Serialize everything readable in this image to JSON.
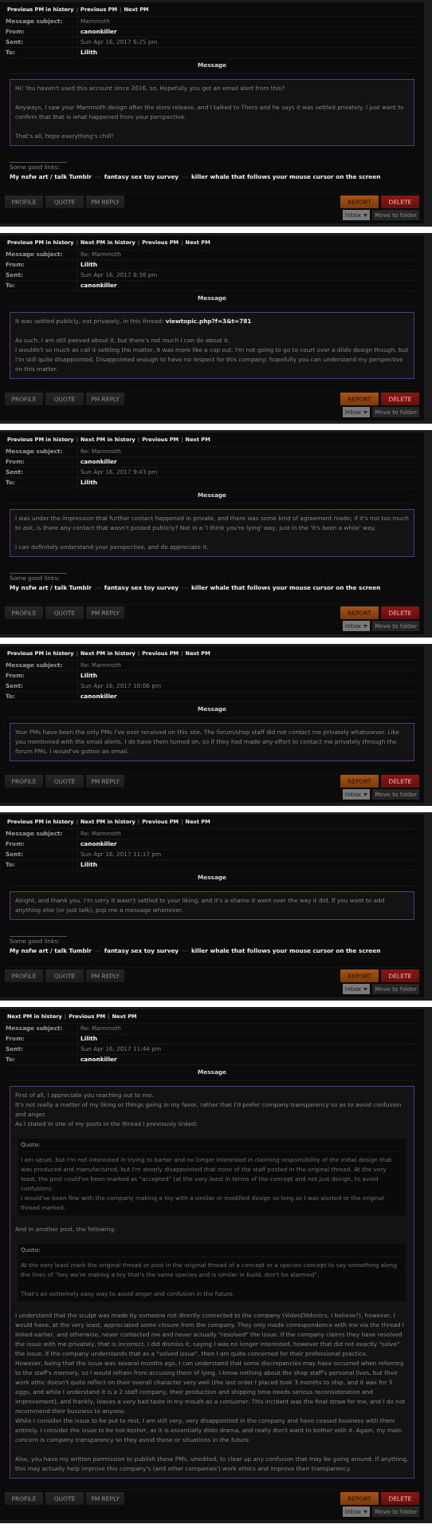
{
  "messages": [
    {
      "nav": [
        {
          "kind": "link",
          "text": "Previous PM in history"
        },
        {
          "kind": "sep",
          "text": "|"
        },
        {
          "kind": "link",
          "text": "Previous PM"
        },
        {
          "kind": "sep",
          "text": "|"
        },
        {
          "kind": "link",
          "text": "Next PM"
        }
      ],
      "fields": [
        {
          "label": "Message subject:",
          "value": "Mammoth",
          "kind": "plain"
        },
        {
          "label": "From:",
          "value": "canonkiller",
          "kind": "user"
        },
        {
          "label": "Sent:",
          "value": "Sun Apr 16, 2017 6:25 pm",
          "kind": "plain"
        },
        {
          "label": "To:",
          "value": "Lilith",
          "kind": "user"
        }
      ],
      "heading": "Message",
      "body": [
        {
          "kind": "text",
          "lines": [
            "Hi! You haven't used this account since 2016, so. Hopefully you get an email alert from this?"
          ]
        },
        {
          "kind": "text",
          "lines": [
            "Anyways, I saw your Mammoth design after the store release, and I talked to Thero and he says it was settled privately. I just want to confirm that that is what happened from your perspective."
          ]
        },
        {
          "kind": "text",
          "lines": [
            "That's all, hope everything's chill!"
          ]
        }
      ],
      "signature": {
        "intro": "Some good links:",
        "parts": [
          {
            "kind": "link",
            "text": "My nsfw art / talk Tumblr"
          },
          {
            "kind": "sep",
            "text": "---"
          },
          {
            "kind": "link",
            "text": "fantasy sex toy survey"
          },
          {
            "kind": "sep",
            "text": "---"
          },
          {
            "kind": "link",
            "text": "killer whale that follows your mouse cursor on the screen"
          }
        ]
      },
      "buttons_left": [
        "PROFILE",
        "QUOTE",
        "PM REPLY"
      ],
      "buttons_right": [
        {
          "kind": "report",
          "text": "REPORT"
        },
        {
          "kind": "delete",
          "text": "DELETE"
        }
      ],
      "folder": {
        "select": "Inbox",
        "button": "Move to folder"
      }
    },
    {
      "nav": [
        {
          "kind": "link",
          "text": "Previous PM in history"
        },
        {
          "kind": "sep",
          "text": "|"
        },
        {
          "kind": "link",
          "text": "Next PM in history"
        },
        {
          "kind": "sep",
          "text": "|"
        },
        {
          "kind": "link",
          "text": "Previous PM"
        },
        {
          "kind": "sep",
          "text": "|"
        },
        {
          "kind": "link",
          "text": "Next PM"
        }
      ],
      "fields": [
        {
          "label": "Message subject:",
          "value": "Re: Mammoth",
          "kind": "plain"
        },
        {
          "label": "From:",
          "value": "Lilith",
          "kind": "user"
        },
        {
          "label": "Sent:",
          "value": "Sun Apr 16, 2017 8:38 pm",
          "kind": "plain"
        },
        {
          "label": "To:",
          "value": "canonkiller",
          "kind": "user"
        }
      ],
      "heading": "Message",
      "body": [
        {
          "kind": "text",
          "lines": [
            "It was settled publicly, not privately, in this thread: "
          ],
          "link": "viewtopic.php?f=3&t=781"
        },
        {
          "kind": "text",
          "lines": [
            "As such, I am still peeved about it, but there's not much I can do about it.",
            "I wouldn't so much as call it settling the matter, it was more like a cop out. I'm not going to go to court over a dildo design though, but I'm still quite disappointed. Disappointed enough to have no respect for this company; hopefully you can understand my perspective on this matter."
          ]
        }
      ],
      "buttons_left": [
        "PROFILE",
        "QUOTE",
        "PM REPLY"
      ],
      "buttons_right": [
        {
          "kind": "report",
          "text": "REPORT"
        },
        {
          "kind": "delete",
          "text": "DELETE"
        }
      ],
      "folder": {
        "select": "Inbox",
        "button": "Move to folder"
      }
    },
    {
      "nav": [
        {
          "kind": "link",
          "text": "Previous PM in history"
        },
        {
          "kind": "sep",
          "text": "|"
        },
        {
          "kind": "link",
          "text": "Next PM in history"
        },
        {
          "kind": "sep",
          "text": "|"
        },
        {
          "kind": "link",
          "text": "Previous PM"
        },
        {
          "kind": "sep",
          "text": "|"
        },
        {
          "kind": "link",
          "text": "Next PM"
        }
      ],
      "fields": [
        {
          "label": "Message subject:",
          "value": "Re: Mammoth",
          "kind": "plain"
        },
        {
          "label": "From:",
          "value": "canonkiller",
          "kind": "user"
        },
        {
          "label": "Sent:",
          "value": "Sun Apr 16, 2017 9:43 pm",
          "kind": "plain"
        },
        {
          "label": "To:",
          "value": "Lilith",
          "kind": "user"
        }
      ],
      "heading": "Message",
      "body": [
        {
          "kind": "text",
          "lines": [
            "I was under the impression that further contact happened in private, and there was some kind of agreement made; if it's not too much to ask, is there any contact that wasn't posted publicly? Not in a 'I think you're lying' way, just in the 'it's been a while' way."
          ]
        },
        {
          "kind": "text",
          "lines": [
            "I can definitely understand your perspective, and do appreciate it."
          ]
        }
      ],
      "signature": {
        "intro": "Some good links:",
        "parts": [
          {
            "kind": "link",
            "text": "My nsfw art / talk Tumblr"
          },
          {
            "kind": "sep",
            "text": "---"
          },
          {
            "kind": "link",
            "text": "fantasy sex toy survey"
          },
          {
            "kind": "sep",
            "text": "---"
          },
          {
            "kind": "link",
            "text": "killer whale that follows your mouse cursor on the screen"
          }
        ]
      },
      "buttons_left": [
        "PROFILE",
        "QUOTE",
        "PM REPLY"
      ],
      "buttons_right": [
        {
          "kind": "report",
          "text": "REPORT"
        },
        {
          "kind": "delete",
          "text": "DELETE"
        }
      ],
      "folder": {
        "select": "Inbox",
        "button": "Move to folder"
      }
    },
    {
      "nav": [
        {
          "kind": "link",
          "text": "Previous PM in history"
        },
        {
          "kind": "sep",
          "text": "|"
        },
        {
          "kind": "link",
          "text": "Next PM in history"
        },
        {
          "kind": "sep",
          "text": "|"
        },
        {
          "kind": "link",
          "text": "Previous PM"
        },
        {
          "kind": "sep",
          "text": "|"
        },
        {
          "kind": "link",
          "text": "Next PM"
        }
      ],
      "fields": [
        {
          "label": "Message subject:",
          "value": "Re: Mammoth",
          "kind": "plain"
        },
        {
          "label": "From:",
          "value": "Lilith",
          "kind": "user"
        },
        {
          "label": "Sent:",
          "value": "Sun Apr 16, 2017 10:06 pm",
          "kind": "plain"
        },
        {
          "label": "To:",
          "value": "canonkiller",
          "kind": "user"
        }
      ],
      "heading": "Message",
      "body": [
        {
          "kind": "text",
          "lines": [
            "Your PMs have been the only PMs I've ever received on this site. The forum/shop staff did not contact me privately whatsoever. Like you mentioned with the email alerts, I do have them turned on, so if they had made any effort to contact me privately through the forum PMs, I would've gotten an email."
          ]
        }
      ],
      "buttons_left": [
        "PROFILE",
        "QUOTE",
        "PM REPLY"
      ],
      "buttons_right": [
        {
          "kind": "report",
          "text": "REPORT"
        },
        {
          "kind": "delete",
          "text": "DELETE"
        }
      ],
      "folder": {
        "select": "Inbox",
        "button": "Move to folder"
      }
    },
    {
      "nav": [
        {
          "kind": "link",
          "text": "Previous PM in history"
        },
        {
          "kind": "sep",
          "text": "|"
        },
        {
          "kind": "link",
          "text": "Next PM in history"
        },
        {
          "kind": "sep",
          "text": "|"
        },
        {
          "kind": "link",
          "text": "Previous PM"
        },
        {
          "kind": "sep",
          "text": "|"
        },
        {
          "kind": "link",
          "text": "Next PM"
        }
      ],
      "fields": [
        {
          "label": "Message subject:",
          "value": "Re: Mammoth",
          "kind": "plain"
        },
        {
          "label": "From:",
          "value": "canonkiller",
          "kind": "user"
        },
        {
          "label": "Sent:",
          "value": "Sun Apr 16, 2017 11:17 pm",
          "kind": "plain"
        },
        {
          "label": "To:",
          "value": "Lilith",
          "kind": "user"
        }
      ],
      "heading": "Message",
      "body": [
        {
          "kind": "text",
          "lines": [
            "Alright, and thank you. I'm sorry it wasn't settled to your liking, and it's a shame it went over the way it did. If you want to add anything else (or just talk), pop me a message whenever."
          ]
        }
      ],
      "signature": {
        "intro": "Some good links:",
        "parts": [
          {
            "kind": "link",
            "text": "My nsfw art / talk Tumblr"
          },
          {
            "kind": "sep",
            "text": "---"
          },
          {
            "kind": "link",
            "text": "fantasy sex toy survey"
          },
          {
            "kind": "sep",
            "text": "---"
          },
          {
            "kind": "link",
            "text": "killer whale that follows your mouse cursor on the screen"
          }
        ]
      },
      "buttons_left": [
        "PROFILE",
        "QUOTE",
        "PM REPLY"
      ],
      "buttons_right": [
        {
          "kind": "report",
          "text": "REPORT"
        },
        {
          "kind": "delete",
          "text": "DELETE"
        }
      ],
      "folder": {
        "select": "Inbox",
        "button": "Move to folder"
      }
    },
    {
      "nav": [
        {
          "kind": "link",
          "text": "Next PM in history"
        },
        {
          "kind": "sep",
          "text": "|"
        },
        {
          "kind": "link",
          "text": "Previous PM"
        },
        {
          "kind": "sep",
          "text": "|"
        },
        {
          "kind": "link",
          "text": "Next PM"
        }
      ],
      "fields": [
        {
          "label": "Message subject:",
          "value": "Re: Mammoth",
          "kind": "plain"
        },
        {
          "label": "From:",
          "value": "Lilith",
          "kind": "user"
        },
        {
          "label": "Sent:",
          "value": "Sun Apr 16, 2017 11:44 pm",
          "kind": "plain"
        },
        {
          "label": "To:",
          "value": "canonkiller",
          "kind": "user"
        }
      ],
      "heading": "Message",
      "body": [
        {
          "kind": "text",
          "lines": [
            "First of all, I appreciate you reaching out to me.",
            "It's not really a matter of my liking or things going in my favor, rather that I'd prefer company transparency so as to avoid confusion and anger.",
            "As I stated in one of my posts in the thread I previously linked:"
          ]
        },
        {
          "kind": "quote",
          "label": "Quote:",
          "paragraphs": [
            {
              "lines": [
                "I am upset, but I'm not interested in trying to barter and no longer interested in claiming responsibility of the initial design that was produced and manufactured, but I'm deeply disappointed that none of the staff posted in the original thread. At the very least, the post could've been marked as \"accepted\" (at the very least in terms of the concept and not just design, to avoid confusion).",
                "I would've been fine with the company making a toy with a similar or modified design so long as I was alerted or the original thread marked."
              ]
            }
          ]
        },
        {
          "kind": "text",
          "lines": [
            "And in another post, the following:"
          ]
        },
        {
          "kind": "quote",
          "label": "Quote:",
          "paragraphs": [
            {
              "lines": [
                "At the very least mark the original thread or post in the original thread of a concept or a species concept to say something along the lines of \"hey we're making a toy that's the same species and is similar in build, don't be alarmed\"."
              ]
            },
            {
              "lines": [
                "That's an extremely easy way to avoid anger and confusion in the future."
              ]
            }
          ]
        },
        {
          "kind": "text",
          "lines": [
            "I understand that the sculpt was made by someone not directly connected to the company (VideoDildonics, I believe?), however, I would have, at the very least, appreciated some closure from the company. They only made correspondence with me via the thread I linked earlier, and otherwise, never contacted me and never actually \"resolved\" the issue. If the company claims they have resolved the issue with me privately, that is incorrect. I did dismiss it, saying I was no longer interested, however that did not exactly \"solve\" the issue. If the company understands that as a \"solved issue\", then I am quite concerned for their professional practice.",
            "However, being that the issue was several months ago, I can understand that some discrepancies may have occurred when referring to the staff's memory, so I would refrain from accusing them of lying. I know nothing about the shop staff's personal lives, but their work ethic doesn't quite reflect on their overall character very well (the last order I placed took 3 months to ship, and it was for 3 eggs, and while I understand it is a 2 staff company, their production and shipping time needs serious reconsideration and improvement), and frankly, leaves a very bad taste in my mouth as a consumer. This incident was the final straw for me, and I do not recommend their business to anyone.",
            "While I consider the issue to be put to rest, I am still very, very disappointed in the company and have ceased business with them entirely. I consider the issue to be not-kosher, as it is essentially dildo drama, and really don't want to bother with it. Again, my main concern is company transparency so they avoid these or situations in the future."
          ]
        },
        {
          "kind": "text",
          "lines": [
            "Also, you have my written permission to publish these PMs, unedited, to clear up any confusion that may be going around. If anything, this may actually help improve this company's (and other companies') work ethics and improve their transparency."
          ]
        }
      ],
      "buttons_left": [
        "PROFILE",
        "QUOTE",
        "PM REPLY"
      ],
      "buttons_right": [
        {
          "kind": "report",
          "text": "REPORT"
        },
        {
          "kind": "delete",
          "text": "DELETE"
        }
      ],
      "folder": {
        "select": "Inbox",
        "button": "Move to folder"
      }
    }
  ]
}
